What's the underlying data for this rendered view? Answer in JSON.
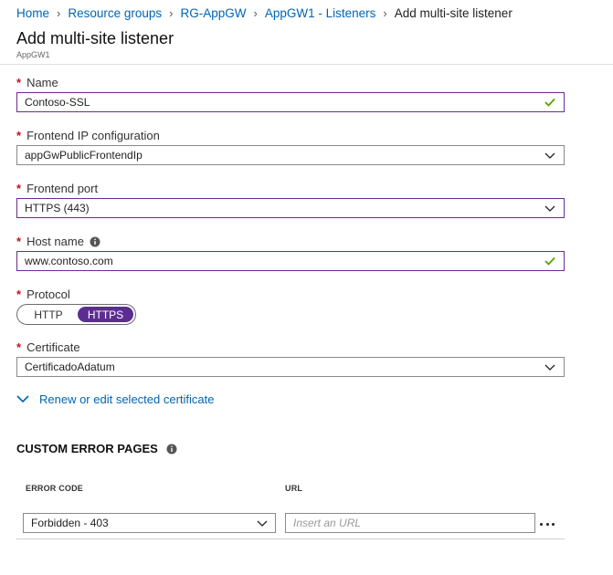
{
  "breadcrumb": {
    "items": [
      "Home",
      "Resource groups",
      "RG-AppGW",
      "AppGW1 - Listeners"
    ],
    "current": "Add multi-site listener"
  },
  "header": {
    "title": "Add multi-site listener",
    "subtitle": "AppGW1"
  },
  "form": {
    "name": {
      "label": "Name",
      "value": "Contoso-SSL"
    },
    "frontend_ip": {
      "label": "Frontend IP configuration",
      "value": "appGwPublicFrontendIp"
    },
    "frontend_port": {
      "label": "Frontend port",
      "value": "HTTPS (443)"
    },
    "host_name": {
      "label": "Host name",
      "value": "www.contoso.com"
    },
    "protocol": {
      "label": "Protocol",
      "options": [
        "HTTP",
        "HTTPS"
      ],
      "selected": "HTTPS"
    },
    "certificate": {
      "label": "Certificate",
      "value": "CertificadoAdatum"
    },
    "renew_link": "Renew or edit selected certificate"
  },
  "custom_error_pages": {
    "title": "CUSTOM ERROR PAGES",
    "columns": {
      "error_code": "ERROR CODE",
      "url": "URL"
    },
    "row": {
      "error_code": "Forbidden - 403",
      "url_placeholder": "Insert an URL"
    }
  },
  "colors": {
    "accent": "#5c2d91",
    "link": "#0065b3",
    "required": "#c50f1f",
    "valid": "#57a300"
  }
}
